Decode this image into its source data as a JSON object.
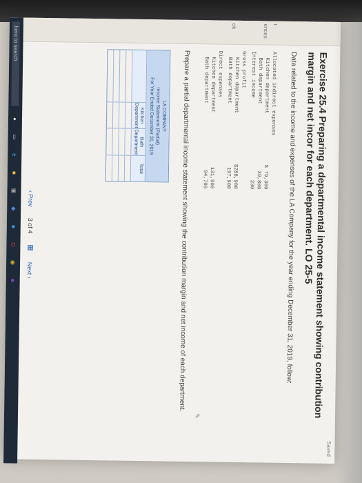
{
  "saved_label": "Saved",
  "nav_fragments": [
    "t",
    "ences",
    "ok"
  ],
  "title": "Exercise 25.4 Preparing a departmental income statement showing contribution margin and net incor for each department. LO 25-5",
  "intro": "Data related to the income and expenses of the LA Company for the year ending December 31, 2019, follow:",
  "data_rows": [
    {
      "label": "Allocated indirect expenses",
      "value": ""
    },
    {
      "label": "  Kitchen department",
      "value": "$ 79,300"
    },
    {
      "label": "  Bath department",
      "value": "39,800"
    },
    {
      "label": "Interest income",
      "value": "230"
    },
    {
      "label": "Gross profit",
      "value": ""
    },
    {
      "label": "  Kitchen department",
      "value": "$288,900"
    },
    {
      "label": "  Bath department",
      "value": "197,900"
    },
    {
      "label": "Direct expenses",
      "value": ""
    },
    {
      "label": "  Kitchen department",
      "value": "131,900"
    },
    {
      "label": "  Bath department",
      "value": "94,700"
    }
  ],
  "prompt": "Prepare a partial departmental income statement showing the contribution margin and net income of each department.",
  "statement": {
    "company": "LA COMPANY",
    "name": "Income Statement (Partial)",
    "period": "For Year Ended December 31, 2019",
    "col_kitchen": "Kitchen Department",
    "col_bath": "Bath Department",
    "col_total": "Total"
  },
  "pager": {
    "prev": "Prev",
    "page": "3",
    "of": "of",
    "total": "4",
    "next": "Next"
  },
  "taskbar": {
    "search_placeholder": "here to search"
  }
}
